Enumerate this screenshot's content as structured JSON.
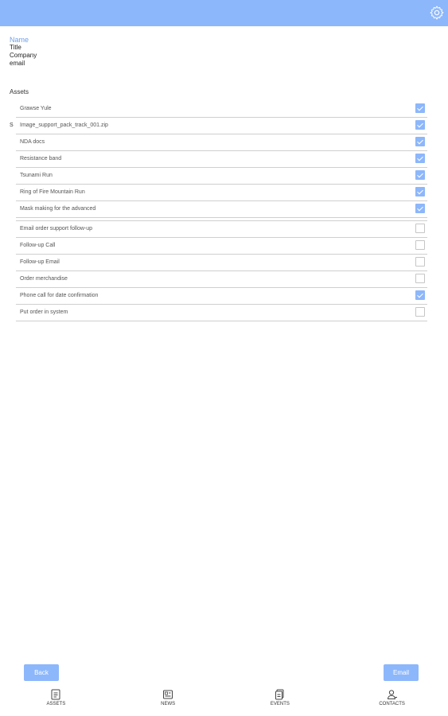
{
  "header": {
    "settings_icon": "gear-icon",
    "color": "#8db7fb"
  },
  "profile": {
    "name": "Name",
    "title": "Title",
    "company": "Company",
    "email": "email"
  },
  "assets_section": {
    "heading": "Assets"
  },
  "assets": [
    {
      "label": "Grawse Yule",
      "checked": true
    },
    {
      "label": "Image_support_pack_track_001.zip",
      "checked": true,
      "marker": "S"
    },
    {
      "label": "NDA docs",
      "checked": true
    },
    {
      "label": "Resistance band",
      "checked": true
    },
    {
      "label": "Tsunami Run",
      "checked": true
    },
    {
      "label": "Ring of Fire Mountain Run",
      "checked": true
    },
    {
      "label": "Mask making for the advanced",
      "checked": true
    }
  ],
  "tasks": [
    {
      "label": "Email order support follow-up",
      "checked": false
    },
    {
      "label": "Follow-up Call",
      "checked": false
    },
    {
      "label": "Follow-up Email",
      "checked": false
    },
    {
      "label": "Order merchandise",
      "checked": false
    },
    {
      "label": "Phone call for date confirmation",
      "checked": true
    },
    {
      "label": "Put order in system",
      "checked": false
    }
  ],
  "buttons": {
    "back": "Back",
    "email": "Email"
  },
  "nav": [
    {
      "label": "ASSETS",
      "icon": "assets-icon"
    },
    {
      "label": "NEWS",
      "icon": "news-icon"
    },
    {
      "label": "EVENTS",
      "icon": "events-icon"
    },
    {
      "label": "CONTACTS",
      "icon": "contacts-icon"
    }
  ]
}
